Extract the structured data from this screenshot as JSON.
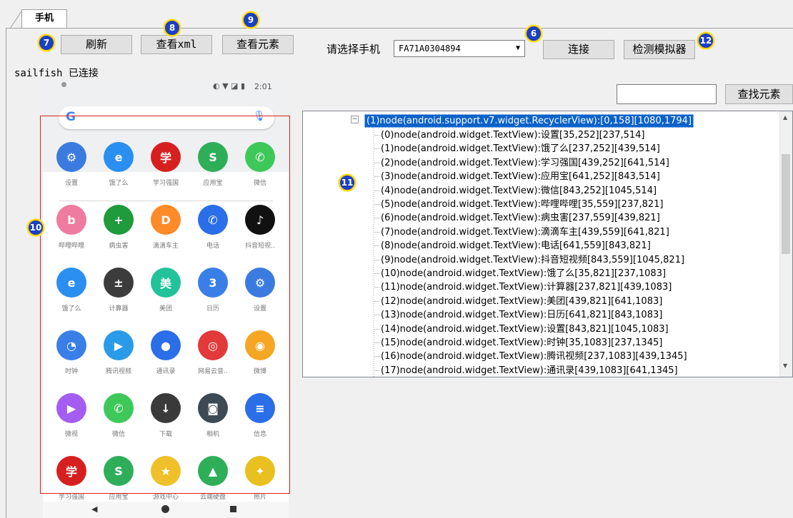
{
  "tab": {
    "label": "手机"
  },
  "toolbar": {
    "refresh": "刷新",
    "view_xml": "查看xml",
    "view_element": "查看元素",
    "select_phone_label": "请选择手机",
    "phone_selected": "FA71A0304894",
    "connect": "连接",
    "detect_emulator": "检测模拟器"
  },
  "badges": {
    "b6": "6",
    "b7": "7",
    "b8": "8",
    "b9": "9",
    "b10": "10",
    "b11": "11",
    "b12": "12"
  },
  "status_text": "sailfish 已连接",
  "search": {
    "button": "查找元素",
    "value": ""
  },
  "phone": {
    "clock": "2:01",
    "apps": [
      {
        "name": "设置",
        "color": "#3b7be0",
        "glyph": "⚙"
      },
      {
        "name": "饿了么",
        "color": "#2a8ff0",
        "glyph": "e"
      },
      {
        "name": "学习强国",
        "color": "#d62020",
        "glyph": "学"
      },
      {
        "name": "应用宝",
        "color": "#2fae5a",
        "glyph": "S"
      },
      {
        "name": "微信",
        "color": "#3ec85a",
        "glyph": "✆"
      },
      {
        "name": "哔哩哔哩",
        "color": "#f07ba0",
        "glyph": "b"
      },
      {
        "name": "病虫害",
        "color": "#1f9a3c",
        "glyph": "+"
      },
      {
        "name": "滴滴车主",
        "color": "#ff8a2a",
        "glyph": "D"
      },
      {
        "name": "电话",
        "color": "#2a6ee8",
        "glyph": "✆"
      },
      {
        "name": "抖音短视..",
        "color": "#111111",
        "glyph": "♪"
      },
      {
        "name": "饿了么",
        "color": "#2a8ff0",
        "glyph": "e"
      },
      {
        "name": "计算器",
        "color": "#3c3c3c",
        "glyph": "±"
      },
      {
        "name": "美团",
        "color": "#22c29a",
        "glyph": "美"
      },
      {
        "name": "日历",
        "color": "#3a7ee8",
        "glyph": "3"
      },
      {
        "name": "设置",
        "color": "#3b7be0",
        "glyph": "⚙"
      },
      {
        "name": "时钟",
        "color": "#3a7ee8",
        "glyph": "◔"
      },
      {
        "name": "腾讯视频",
        "color": "#2a9be8",
        "glyph": "▶"
      },
      {
        "name": "通讯录",
        "color": "#2a6ee8",
        "glyph": "●"
      },
      {
        "name": "网易云音..",
        "color": "#e23a3a",
        "glyph": "◎"
      },
      {
        "name": "微博",
        "color": "#f5a623",
        "glyph": "◉"
      },
      {
        "name": "微视",
        "color": "#a55cf0",
        "glyph": "▶"
      },
      {
        "name": "微信",
        "color": "#3ec85a",
        "glyph": "✆"
      },
      {
        "name": "下载",
        "color": "#3a3a3a",
        "glyph": "↓"
      },
      {
        "name": "相机",
        "color": "#3d4a56",
        "glyph": "◙"
      },
      {
        "name": "信息",
        "color": "#2a6ee8",
        "glyph": "≡"
      },
      {
        "name": "学习强国",
        "color": "#d62020",
        "glyph": "学"
      },
      {
        "name": "应用宝",
        "color": "#2fae5a",
        "glyph": "S"
      },
      {
        "name": "游戏中心",
        "color": "#f0c02a",
        "glyph": "★"
      },
      {
        "name": "云端硬盘",
        "color": "#2fae5a",
        "glyph": "▲"
      },
      {
        "name": "照片",
        "color": "#e8c020",
        "glyph": "✦"
      }
    ]
  },
  "tree": {
    "root": "(1)node(android.support.v7.widget.RecyclerView):[0,158][1080,1794]",
    "items": [
      "(0)node(android.widget.TextView):设置[35,252][237,514]",
      "(1)node(android.widget.TextView):饿了么[237,252][439,514]",
      "(2)node(android.widget.TextView):学习强国[439,252][641,514]",
      "(3)node(android.widget.TextView):应用宝[641,252][843,514]",
      "(4)node(android.widget.TextView):微信[843,252][1045,514]",
      "(5)node(android.widget.TextView):哔哩哔哩[35,559][237,821]",
      "(6)node(android.widget.TextView):病虫害[237,559][439,821]",
      "(7)node(android.widget.TextView):滴滴车主[439,559][641,821]",
      "(8)node(android.widget.TextView):电话[641,559][843,821]",
      "(9)node(android.widget.TextView):抖音短视频[843,559][1045,821]",
      "(10)node(android.widget.TextView):饿了么[35,821][237,1083]",
      "(11)node(android.widget.TextView):计算器[237,821][439,1083]",
      "(12)node(android.widget.TextView):美团[439,821][641,1083]",
      "(13)node(android.widget.TextView):日历[641,821][843,1083]",
      "(14)node(android.widget.TextView):设置[843,821][1045,1083]",
      "(15)node(android.widget.TextView):时钟[35,1083][237,1345]",
      "(16)node(android.widget.TextView):腾讯视频[237,1083][439,1345]",
      "(17)node(android.widget.TextView):通讯录[439,1083][641,1345]"
    ]
  }
}
